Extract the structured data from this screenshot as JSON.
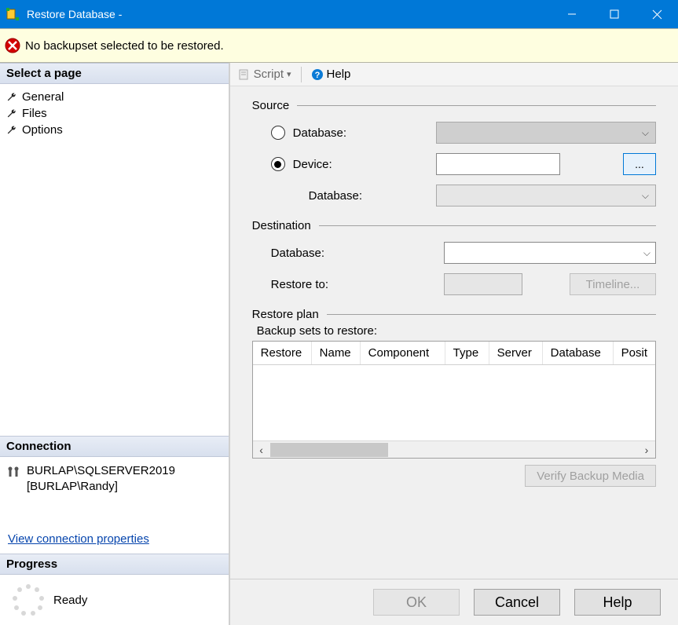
{
  "window": {
    "title": "Restore Database -"
  },
  "message": {
    "text": "No backupset selected to be restored."
  },
  "sidebar": {
    "select_page_header": "Select a page",
    "pages": [
      {
        "label": "General"
      },
      {
        "label": "Files"
      },
      {
        "label": "Options"
      }
    ],
    "connection_header": "Connection",
    "connection_server": "BURLAP\\SQLSERVER2019",
    "connection_user": "[BURLAP\\Randy]",
    "view_connection_link": "View connection properties",
    "progress_header": "Progress",
    "progress_status": "Ready"
  },
  "toolbar": {
    "script_label": "Script",
    "help_label": "Help"
  },
  "form": {
    "source_label": "Source",
    "source_database_label": "Database:",
    "source_device_label": "Device:",
    "source_device_db_label": "Database:",
    "browse_label": "...",
    "destination_label": "Destination",
    "dest_database_label": "Database:",
    "dest_restore_to_label": "Restore to:",
    "timeline_label": "Timeline...",
    "restore_plan_label": "Restore plan",
    "backup_sets_label": "Backup sets to restore:",
    "columns": [
      "Restore",
      "Name",
      "Component",
      "Type",
      "Server",
      "Database",
      "Position"
    ],
    "verify_label": "Verify Backup Media"
  },
  "footer": {
    "ok": "OK",
    "cancel": "Cancel",
    "help": "Help"
  }
}
